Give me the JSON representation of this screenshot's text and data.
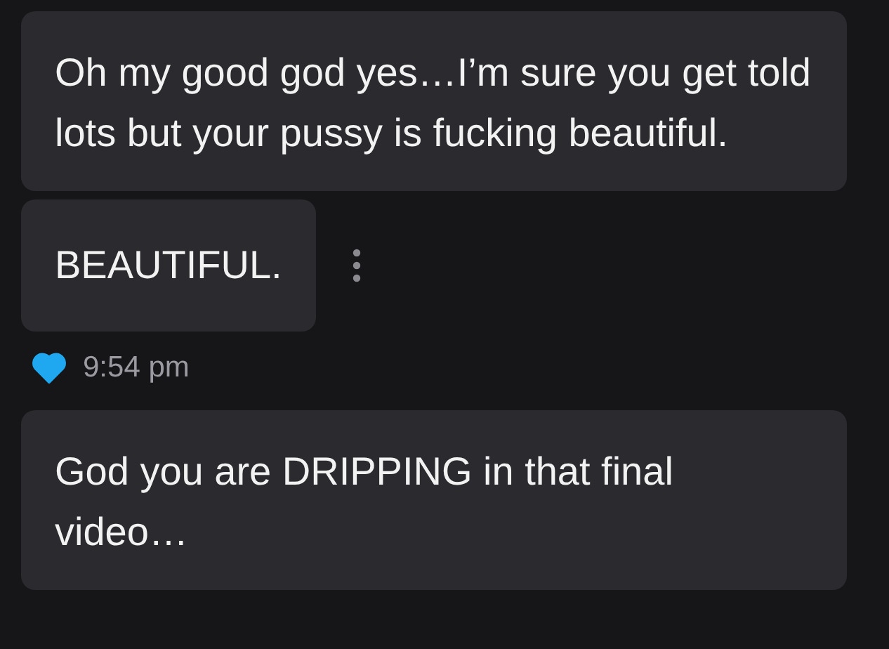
{
  "messages": [
    {
      "text": "Oh my good god yes…I’m sure you get told lots but your pussy is fucking beautiful.",
      "menu": false
    },
    {
      "text": "BEAUTIFUL.",
      "menu": true
    }
  ],
  "meta": {
    "liked": true,
    "time": "9:54 pm"
  },
  "next_messages": [
    {
      "text": "God you are DRIPPING in that final video…"
    }
  ]
}
